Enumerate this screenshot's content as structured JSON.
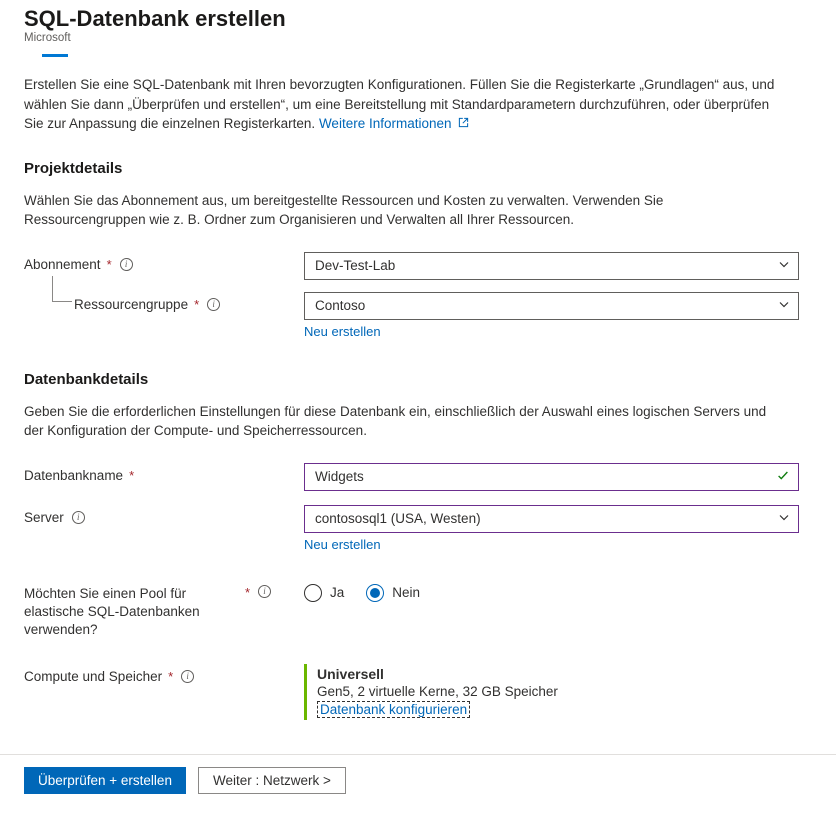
{
  "header": {
    "title": "SQL-Datenbank erstellen",
    "subtitle": "Microsoft"
  },
  "intro": {
    "text": "Erstellen Sie eine SQL-Datenbank mit Ihren bevorzugten Konfigurationen. Füllen Sie die Registerkarte „Grundlagen“ aus, und wählen Sie dann „Überprüfen und erstellen“, um eine Bereitstellung mit Standardparametern durchzuführen, oder überprüfen Sie zur Anpassung die einzelnen Registerkarten. ",
    "link_text": "Weitere Informationen"
  },
  "project": {
    "section_title": "Projektdetails",
    "section_desc": "Wählen Sie das Abonnement aus, um bereitgestellte Ressourcen und Kosten zu verwalten. Verwenden Sie Ressourcengruppen wie z. B. Ordner zum Organisieren und Verwalten all Ihrer Ressourcen.",
    "subscription_label": "Abonnement",
    "subscription_value": "Dev-Test-Lab",
    "rg_label": "Ressourcengruppe",
    "rg_value": "Contoso",
    "rg_new_link": "Neu erstellen"
  },
  "db": {
    "section_title": "Datenbankdetails",
    "section_desc": "Geben Sie die erforderlichen Einstellungen für diese Datenbank ein, einschließlich der Auswahl eines logischen Servers und der Konfiguration der Compute- und Speicherressourcen.",
    "name_label": "Datenbankname",
    "name_value": "Widgets",
    "server_label": "Server",
    "server_value": "contososql1 (USA, Westen)",
    "server_new_link": "Neu erstellen",
    "elastic_label": "Möchten Sie einen Pool für elastische SQL-Datenbanken verwenden?",
    "elastic_yes": "Ja",
    "elastic_no": "Nein",
    "compute_label": "Compute und Speicher",
    "compute_title": "Universell",
    "compute_details": "Gen5, 2 virtuelle Kerne, 32 GB Speicher",
    "compute_link": "Datenbank konfigurieren"
  },
  "footer": {
    "primary": "Überprüfen + erstellen",
    "secondary": "Weiter : Netzwerk >"
  }
}
